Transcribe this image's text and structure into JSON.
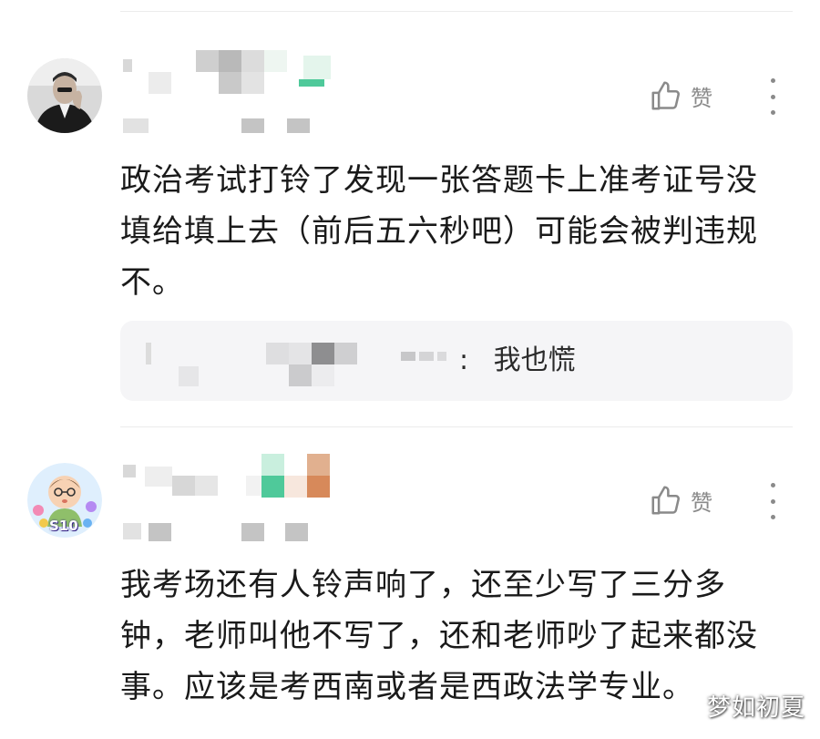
{
  "comments": [
    {
      "like_label": "赞",
      "text": "政治考试打铃了发现一张答题卡上准考证号没填给填上去（前后五六秒吧）可能会被判违规不。",
      "reply": {
        "separator": ":",
        "text": "我也慌"
      }
    },
    {
      "avatar_badge": "S10",
      "like_label": "赞",
      "text": "我考场还有人铃声响了，还至少写了三分多钟，老师叫他不写了，还和老师吵了起来都没事。应该是考西南或者是西政法学专业。"
    }
  ],
  "watermark": "梦如初夏",
  "icons": {
    "like": "thumbs-up-icon",
    "more": "more-vertical-icon"
  },
  "colors": {
    "text_primary": "#1a1a1a",
    "text_secondary": "#8a8a8a",
    "reply_bg": "#f5f5f7",
    "divider": "#ececec",
    "mosaic_green": "#4fc99a",
    "mosaic_orange": "#d7895a"
  }
}
